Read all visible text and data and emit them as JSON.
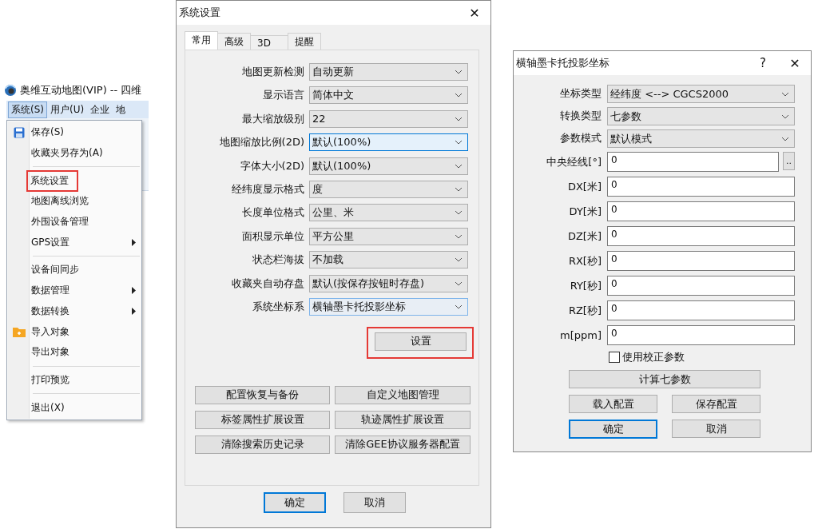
{
  "app": {
    "title": "奥维互动地图(VIP) -- 四维",
    "menubar": [
      {
        "label": "系统(S)",
        "selected": true
      },
      {
        "label": "用户(U)",
        "selected": false
      },
      {
        "label": "企业",
        "selected": false
      },
      {
        "label": "地",
        "selected": false
      }
    ],
    "menu": [
      {
        "kind": "item",
        "label": "保存(S)",
        "has_submenu": false,
        "annotated": false
      },
      {
        "kind": "item",
        "label": "收藏夹另存为(A)",
        "has_submenu": false,
        "annotated": false
      },
      {
        "kind": "separator"
      },
      {
        "kind": "item",
        "label": "系统设置",
        "has_submenu": false,
        "annotated": true
      },
      {
        "kind": "item",
        "label": "地图离线浏览",
        "has_submenu": false,
        "annotated": false
      },
      {
        "kind": "item",
        "label": "外围设备管理",
        "has_submenu": false,
        "annotated": false
      },
      {
        "kind": "item",
        "label": "GPS设置",
        "has_submenu": true,
        "annotated": false
      },
      {
        "kind": "separator"
      },
      {
        "kind": "item",
        "label": "设备间同步",
        "has_submenu": false,
        "annotated": false
      },
      {
        "kind": "item",
        "label": "数据管理",
        "has_submenu": true,
        "annotated": false
      },
      {
        "kind": "item",
        "label": "数据转换",
        "has_submenu": true,
        "annotated": false
      },
      {
        "kind": "item",
        "label": "导入对象",
        "has_submenu": false,
        "annotated": false
      },
      {
        "kind": "item",
        "label": "导出对象",
        "has_submenu": false,
        "annotated": false
      },
      {
        "kind": "separator"
      },
      {
        "kind": "item",
        "label": "打印预览",
        "has_submenu": false,
        "annotated": false
      },
      {
        "kind": "separator"
      },
      {
        "kind": "item",
        "label": "退出(X)",
        "has_submenu": false,
        "annotated": false
      }
    ]
  },
  "settings_dialog": {
    "title": "系统设置",
    "close": "✕",
    "tabs": [
      {
        "label": "常用",
        "selected": true
      },
      {
        "label": "高级",
        "selected": false
      },
      {
        "label": "3D",
        "selected": false
      },
      {
        "label": "提醒",
        "selected": false
      }
    ],
    "rows": [
      {
        "label": "地图更新检测",
        "value": "自动更新",
        "focused": false,
        "hovered": false
      },
      {
        "label": "显示语言",
        "value": "简体中文",
        "focused": false,
        "hovered": false
      },
      {
        "label": "最大缩放级别",
        "value": "22",
        "focused": false,
        "hovered": false
      },
      {
        "label": "地图缩放比例(2D)",
        "value": "默认(100%)",
        "focused": true,
        "hovered": false
      },
      {
        "label": "字体大小(2D)",
        "value": "默认(100%)",
        "focused": false,
        "hovered": false
      },
      {
        "label": "经纬度显示格式",
        "value": "度",
        "focused": false,
        "hovered": false
      },
      {
        "label": "长度单位格式",
        "value": "公里、米",
        "focused": false,
        "hovered": false
      },
      {
        "label": "面积显示单位",
        "value": "平方公里",
        "focused": false,
        "hovered": false
      },
      {
        "label": "状态栏海拔",
        "value": "不加载",
        "focused": false,
        "hovered": false
      },
      {
        "label": "收藏夹自动存盘",
        "value": "默认(按保存按钮时存盘)",
        "focused": false,
        "hovered": false
      },
      {
        "label": "系统坐标系",
        "value": "横轴墨卡托投影坐标",
        "focused": false,
        "hovered": true
      }
    ],
    "setup_button": {
      "label": "设置",
      "annotated": true
    },
    "buttons": [
      "配置恢复与备份",
      "自定义地图管理",
      "标签属性扩展设置",
      "轨迹属性扩展设置",
      "清除搜索历史记录",
      "清除GEE协议服务器配置"
    ],
    "footer_buttons": [
      {
        "label": "确定",
        "default": true
      },
      {
        "label": "取消",
        "default": false
      }
    ]
  },
  "projection_dialog": {
    "title": "横轴墨卡托投影坐标",
    "help": "?",
    "close": "✕",
    "combos": [
      {
        "label": "坐标类型",
        "value": "经纬度 <--> CGCS2000"
      },
      {
        "label": "转换类型",
        "value": "七参数"
      },
      {
        "label": "参数模式",
        "value": "默认模式"
      }
    ],
    "fields": [
      {
        "label": "中央经线[°]",
        "value": "0",
        "browse": ".."
      },
      {
        "label": "DX[米]",
        "value": "0"
      },
      {
        "label": "DY[米]",
        "value": "0"
      },
      {
        "label": "DZ[米]",
        "value": "0"
      },
      {
        "label": "RX[秒]",
        "value": "0"
      },
      {
        "label": "RY[秒]",
        "value": "0"
      },
      {
        "label": "RZ[秒]",
        "value": "0"
      },
      {
        "label": "m[ppm]",
        "value": "0"
      }
    ],
    "checkbox": {
      "label": "使用校正参数",
      "checked": false
    },
    "compute_button": "计算七参数",
    "buttons": [
      {
        "label": "载入配置",
        "default": false
      },
      {
        "label": "保存配置",
        "default": false
      },
      {
        "label": "确定",
        "default": true
      },
      {
        "label": "取消",
        "default": false
      }
    ]
  }
}
